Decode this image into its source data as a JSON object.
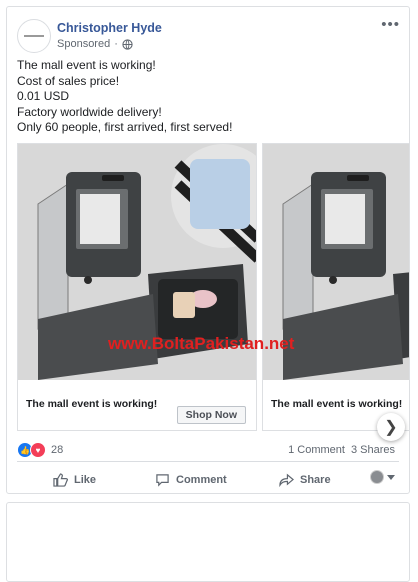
{
  "post": {
    "author": "Christopher Hyde",
    "sponsored_label": "Sponsored",
    "lines": [
      "The mall event is working!",
      "Cost of sales price!",
      "0.01 USD",
      "Factory worldwide delivery!",
      "Only 60 people, first arrived, first served!"
    ]
  },
  "carousel": {
    "cards": [
      {
        "caption": "The mall event is working!",
        "cta": "Shop Now"
      },
      {
        "caption": "The mall event is working!"
      }
    ],
    "watermark": "www.BoltaPakistan.net"
  },
  "engagement": {
    "reaction_count": "28",
    "comments": "1 Comment",
    "shares": "3 Shares"
  },
  "actions": {
    "like": "Like",
    "comment": "Comment",
    "share": "Share"
  },
  "icons": [
    "globe-icon",
    "more-icon",
    "like-icon",
    "love-icon",
    "chevron-right-icon",
    "comment-icon",
    "share-icon",
    "avatar-icon",
    "caret-down-icon"
  ],
  "colors": {
    "link": "#385898",
    "like": "#1877f2",
    "love": "#f33e58",
    "watermark": "#e02020"
  }
}
